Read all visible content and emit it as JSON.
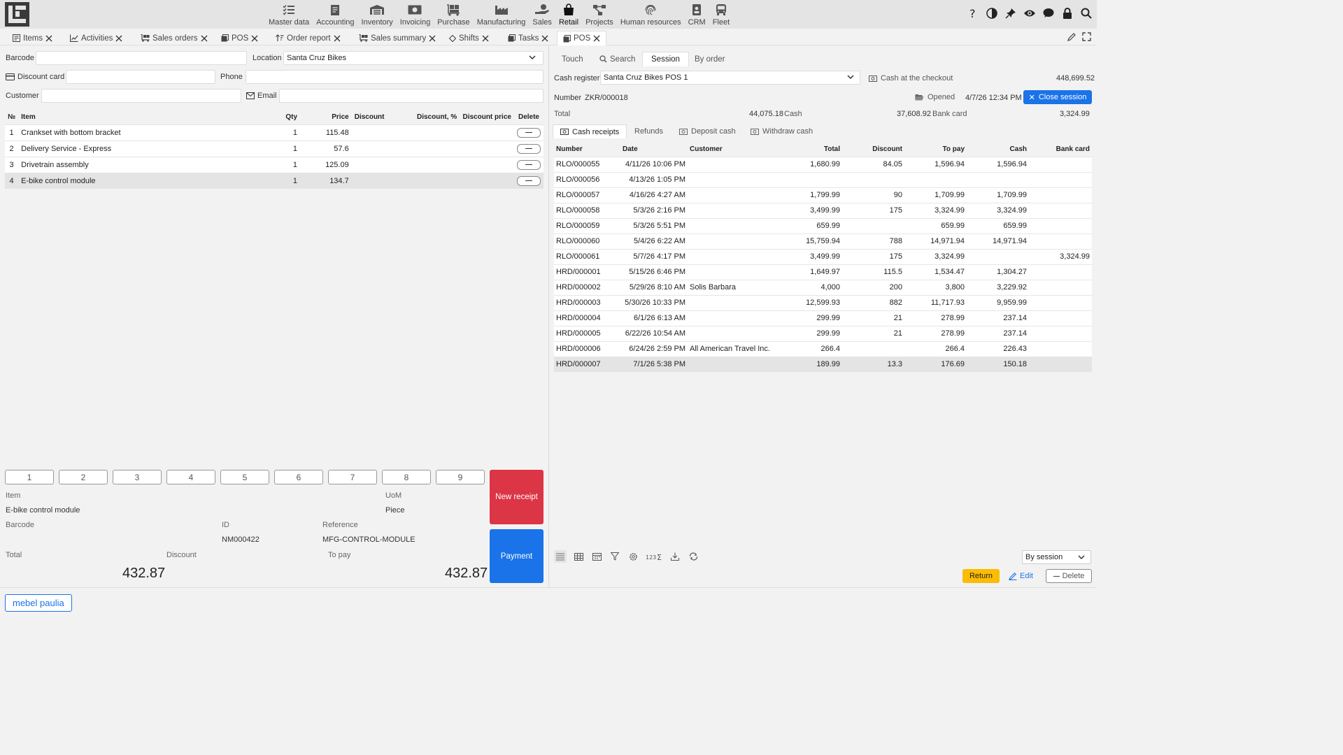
{
  "nav": {
    "modules": [
      {
        "label": "Master data",
        "icon": "list-check-icon"
      },
      {
        "label": "Accounting",
        "icon": "ledger-icon"
      },
      {
        "label": "Inventory",
        "icon": "warehouse-icon"
      },
      {
        "label": "Invoicing",
        "icon": "money-icon"
      },
      {
        "label": "Purchase",
        "icon": "dolly-icon"
      },
      {
        "label": "Manufacturing",
        "icon": "factory-icon"
      },
      {
        "label": "Sales",
        "icon": "hand-money-icon"
      },
      {
        "label": "Retail",
        "icon": "shopping-bag-icon"
      },
      {
        "label": "Projects",
        "icon": "project-diagram-icon"
      },
      {
        "label": "Human resources",
        "icon": "fingerprint-icon"
      },
      {
        "label": "CRM",
        "icon": "id-badge-icon"
      },
      {
        "label": "Fleet",
        "icon": "bus-icon"
      }
    ],
    "active_module": "Retail"
  },
  "tabs": [
    {
      "label": "Items",
      "icon": "items-icon"
    },
    {
      "label": "Activities",
      "icon": "chart-line-icon"
    },
    {
      "label": "Sales orders",
      "icon": "dolly-icon"
    },
    {
      "label": "POS",
      "icon": "pos-icon"
    },
    {
      "label": "Order report",
      "icon": "sort-icon"
    },
    {
      "label": "Sales summary",
      "icon": "dolly-icon"
    },
    {
      "label": "Shifts",
      "icon": "diamond-icon"
    },
    {
      "label": "Tasks",
      "icon": "tasks-icon"
    },
    {
      "label": "POS",
      "icon": "pos-icon"
    }
  ],
  "form": {
    "barcode_label": "Barcode",
    "barcode_value": "",
    "location_label": "Location",
    "location_value": "Santa Cruz Bikes",
    "discount_card_label": "Discount card",
    "discount_card_value": "",
    "phone_label": "Phone",
    "phone_value": "",
    "customer_label": "Customer",
    "customer_value": "",
    "email_label": "Email",
    "email_value": ""
  },
  "items_table": {
    "headers": {
      "num": "№",
      "item": "Item",
      "qty": "Qty",
      "price": "Price",
      "discount": "Discount",
      "discount_pct": "Discount, %",
      "discount_price": "Discount price",
      "delete": "Delete"
    },
    "rows": [
      {
        "num": "1",
        "item": "Crankset with bottom bracket",
        "qty": "1",
        "price": "115.48"
      },
      {
        "num": "2",
        "item": "Delivery Service - Express",
        "qty": "1",
        "price": "57.6"
      },
      {
        "num": "3",
        "item": "Drivetrain assembly",
        "qty": "1",
        "price": "125.09"
      },
      {
        "num": "4",
        "item": "E-bike control module",
        "qty": "1",
        "price": "134.7"
      }
    ]
  },
  "numpad": [
    "1",
    "2",
    "3",
    "4",
    "5",
    "6",
    "7",
    "8",
    "9"
  ],
  "detail": {
    "item_label": "Item",
    "item_value": "E-bike control module",
    "uom_label": "UoM",
    "uom_value": "Piece",
    "barcode_label": "Barcode",
    "id_label": "ID",
    "id_value": "NM000422",
    "reference_label": "Reference",
    "reference_value": "MFG-CONTROL-MODULE",
    "total_label": "Total",
    "total_value": "432.87",
    "discount_label": "Discount",
    "topay_label": "To pay",
    "topay_value": "432.87"
  },
  "buttons": {
    "new_receipt": "New receipt",
    "payment": "Payment"
  },
  "user": "mebel paulia",
  "right": {
    "tabs": [
      "Touch",
      "Search",
      "Session",
      "By order"
    ],
    "cash_register_label": "Cash register",
    "cash_register_value": "Santa Cruz Bikes POS 1",
    "cash_checkout_label": "Cash at the checkout",
    "cash_checkout_value": "448,699.52",
    "number_label": "Number",
    "number_value": "ZKR/000018",
    "opened_label": "Opened",
    "opened_value": "4/7/26 12:34 PM",
    "close_session": "Close session",
    "total_label": "Total",
    "total_value": "44,075.18",
    "cash_label": "Cash",
    "cash_value": "37,608.92",
    "bankcard_label": "Bank card",
    "bankcard_value": "3,324.99",
    "subtabs": [
      "Cash receipts",
      "Refunds",
      "Deposit cash",
      "Withdraw cash"
    ],
    "headers": {
      "number": "Number",
      "date": "Date",
      "customer": "Customer",
      "total": "Total",
      "discount": "Discount",
      "topay": "To pay",
      "cash": "Cash",
      "bankcard": "Bank card"
    },
    "rows": [
      {
        "number": "RLO/000055",
        "date": "4/11/26 10:06 PM",
        "customer": "",
        "total": "1,680.99",
        "discount": "84.05",
        "topay": "1,596.94",
        "cash": "1,596.94",
        "bankcard": ""
      },
      {
        "number": "RLO/000056",
        "date": "4/13/26 1:05 PM",
        "customer": "",
        "total": "",
        "discount": "",
        "topay": "",
        "cash": "",
        "bankcard": ""
      },
      {
        "number": "RLO/000057",
        "date": "4/16/26 4:27 AM",
        "customer": "",
        "total": "1,799.99",
        "discount": "90",
        "topay": "1,709.99",
        "cash": "1,709.99",
        "bankcard": ""
      },
      {
        "number": "RLO/000058",
        "date": "5/3/26 2:16 PM",
        "customer": "",
        "total": "3,499.99",
        "discount": "175",
        "topay": "3,324.99",
        "cash": "3,324.99",
        "bankcard": ""
      },
      {
        "number": "RLO/000059",
        "date": "5/3/26 5:51 PM",
        "customer": "",
        "total": "659.99",
        "discount": "",
        "topay": "659.99",
        "cash": "659.99",
        "bankcard": ""
      },
      {
        "number": "RLO/000060",
        "date": "5/4/26 6:22 AM",
        "customer": "",
        "total": "15,759.94",
        "discount": "788",
        "topay": "14,971.94",
        "cash": "14,971.94",
        "bankcard": ""
      },
      {
        "number": "RLO/000061",
        "date": "5/7/26 4:17 PM",
        "customer": "",
        "total": "3,499.99",
        "discount": "175",
        "topay": "3,324.99",
        "cash": "",
        "bankcard": "3,324.99"
      },
      {
        "number": "HRD/000001",
        "date": "5/15/26 6:46 PM",
        "customer": "",
        "total": "1,649.97",
        "discount": "115.5",
        "topay": "1,534.47",
        "cash": "1,304.27",
        "bankcard": ""
      },
      {
        "number": "HRD/000002",
        "date": "5/29/26 8:10 AM",
        "customer": "Solis Barbara",
        "total": "4,000",
        "discount": "200",
        "topay": "3,800",
        "cash": "3,229.92",
        "bankcard": ""
      },
      {
        "number": "HRD/000003",
        "date": "5/30/26 10:33 PM",
        "customer": "",
        "total": "12,599.93",
        "discount": "882",
        "topay": "11,717.93",
        "cash": "9,959.99",
        "bankcard": ""
      },
      {
        "number": "HRD/000004",
        "date": "6/1/26 6:13 AM",
        "customer": "",
        "total": "299.99",
        "discount": "21",
        "topay": "278.99",
        "cash": "237.14",
        "bankcard": ""
      },
      {
        "number": "HRD/000005",
        "date": "6/22/26 10:54 AM",
        "customer": "",
        "total": "299.99",
        "discount": "21",
        "topay": "278.99",
        "cash": "237.14",
        "bankcard": ""
      },
      {
        "number": "HRD/000006",
        "date": "6/24/26 2:59 PM",
        "customer": "All American Travel Inc.",
        "total": "266.4",
        "discount": "",
        "topay": "266.4",
        "cash": "226.43",
        "bankcard": ""
      },
      {
        "number": "HRD/000007",
        "date": "7/1/26 5:38 PM",
        "customer": "",
        "total": "189.99",
        "discount": "13.3",
        "topay": "176.69",
        "cash": "150.18",
        "bankcard": ""
      }
    ],
    "by_session": "By session",
    "return_label": "Return",
    "edit_label": "Edit",
    "delete_label": "Delete"
  }
}
